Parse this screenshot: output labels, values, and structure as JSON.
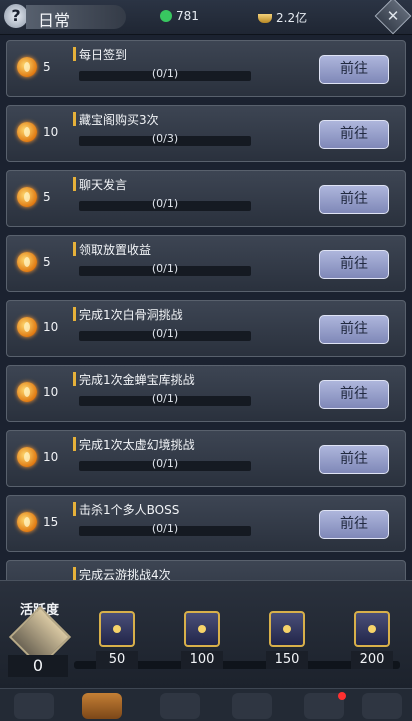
{
  "header": {
    "title": "日常",
    "resource_jade": "781",
    "resource_ingot": "2.2亿"
  },
  "tasks": [
    {
      "points": "5",
      "name": "每日签到",
      "progress": "(0/1)",
      "button": "前往"
    },
    {
      "points": "10",
      "name": "藏宝阁购买3次",
      "progress": "(0/3)",
      "button": "前往"
    },
    {
      "points": "5",
      "name": "聊天发言",
      "progress": "(0/1)",
      "button": "前往"
    },
    {
      "points": "5",
      "name": "领取放置收益",
      "progress": "(0/1)",
      "button": "前往"
    },
    {
      "points": "10",
      "name": "完成1次白骨洞挑战",
      "progress": "(0/1)",
      "button": "前往"
    },
    {
      "points": "10",
      "name": "完成1次金蝉宝库挑战",
      "progress": "(0/1)",
      "button": "前往"
    },
    {
      "points": "10",
      "name": "完成1次太虚幻境挑战",
      "progress": "(0/1)",
      "button": "前往"
    },
    {
      "points": "15",
      "name": "击杀1个多人BOSS",
      "progress": "(0/1)",
      "button": "前往"
    },
    {
      "points": "",
      "name": "完成云游挑战4次",
      "progress": "",
      "button": ""
    }
  ],
  "activity": {
    "label": "活跃度",
    "value": "0",
    "milestones": [
      "50",
      "100",
      "150",
      "200"
    ]
  },
  "icons": {
    "help": "help-icon",
    "close": "close-icon",
    "task_points": "flame-coin-icon",
    "chest": "treasure-chest-icon"
  }
}
